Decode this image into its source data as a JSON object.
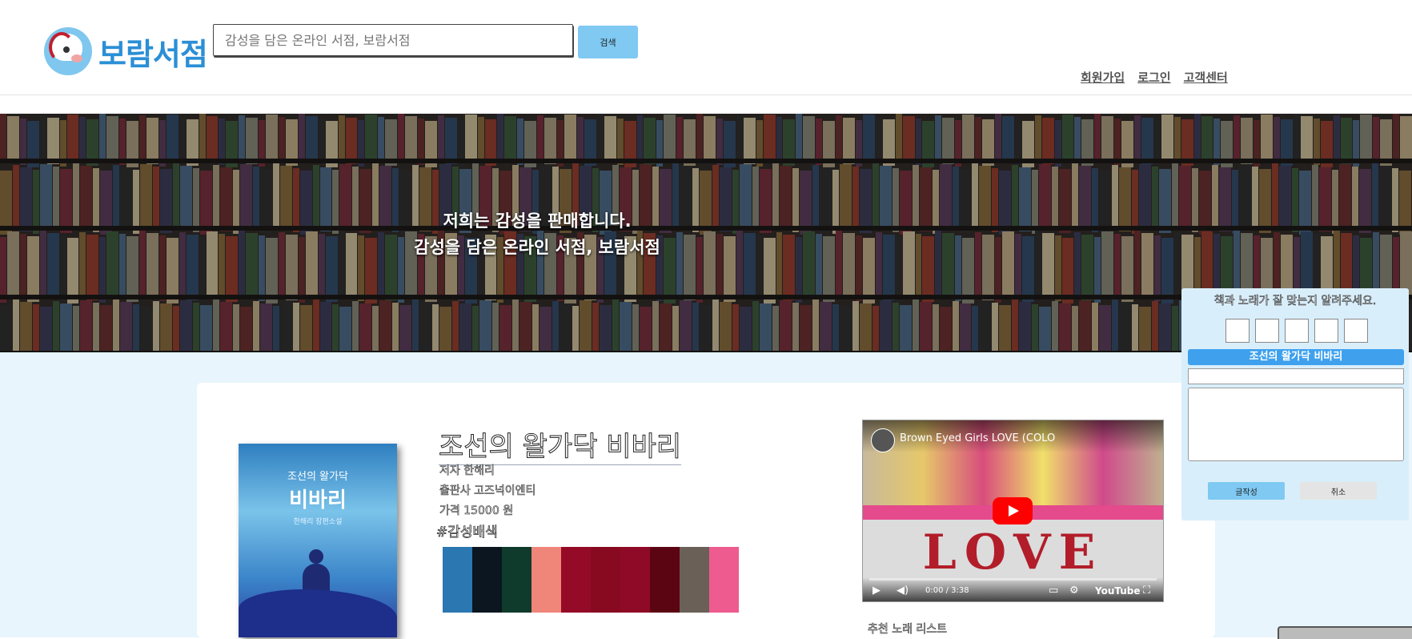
{
  "header": {
    "logo_text": "보람서점",
    "search": {
      "placeholder": "감성을 담은 온라인 서점, 보람서점"
    },
    "search_button": "검색",
    "nav": [
      "회원가입",
      "로그인",
      "고객센터"
    ]
  },
  "banner": {
    "line1": "저희는 감성을 판매합니다.",
    "line2": "감성을 담은 온라인 서점, 보람서점"
  },
  "book": {
    "cover": {
      "small_title": "조선의 왈가닥",
      "big_title": "비바리",
      "author": "한해리 장편소설"
    },
    "title": "조선의 왈가닥 비바리",
    "author": "저자 한해리",
    "publisher": "출판사 고즈넉이엔티",
    "price": "가격 15000 원",
    "hashtag": "#감성배색",
    "palette": [
      "#2a77b1",
      "#0b1620",
      "#0f3b2c",
      "#f08579",
      "#950a27",
      "#870a21",
      "#8f0a26",
      "#5c0512",
      "#6a6058",
      "#ee5b8e"
    ]
  },
  "video": {
    "title": "Brown Eyed Girls LOVE (COLO",
    "time": "0:00 / 3:38",
    "overlay_text": "LOVE",
    "logo": "YouTube"
  },
  "recommend_title": "추천 노래 리스트",
  "popup": {
    "question": "책과 노래가 잘 맞는지 알려주세요.",
    "book_name": "조선의 왈가닥 비바리",
    "ok": "글작성",
    "cancel": "취소"
  }
}
